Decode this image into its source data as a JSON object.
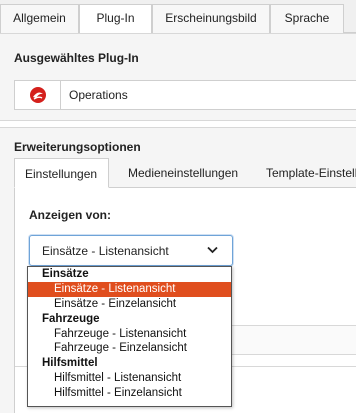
{
  "top_tabs": [
    {
      "label": "Allgemein"
    },
    {
      "label": "Plug-In"
    },
    {
      "label": "Erscheinungsbild"
    },
    {
      "label": "Sprache"
    }
  ],
  "plugin_section": {
    "title": "Ausgewähltes Plug-In",
    "plugin_name": "Operations",
    "icon": "plugin-logo-icon"
  },
  "extension_section": {
    "title": "Erweiterungsoptionen",
    "tabs": [
      {
        "label": "Einstellungen"
      },
      {
        "label": "Medieneinstellungen"
      },
      {
        "label": "Template-Einstell"
      }
    ],
    "field_label": "Anzeigen von:",
    "select_value": "Einsätze - Listenansicht"
  },
  "dropdown": {
    "groups": [
      {
        "label": "Einsätze",
        "options": [
          "Einsätze - Listenansicht",
          "Einsätze - Einzelansicht"
        ]
      },
      {
        "label": "Fahrzeuge",
        "options": [
          "Fahrzeuge - Listenansicht",
          "Fahrzeuge - Einzelansicht"
        ]
      },
      {
        "label": "Hilfsmittel",
        "options": [
          "Hilfsmittel - Listenansicht",
          "Hilfsmittel - Einzelansicht"
        ]
      }
    ],
    "selected": "Einsätze - Listenansicht"
  },
  "colors": {
    "accent": "#e04e1e",
    "focus_border": "#6fa4d8"
  }
}
